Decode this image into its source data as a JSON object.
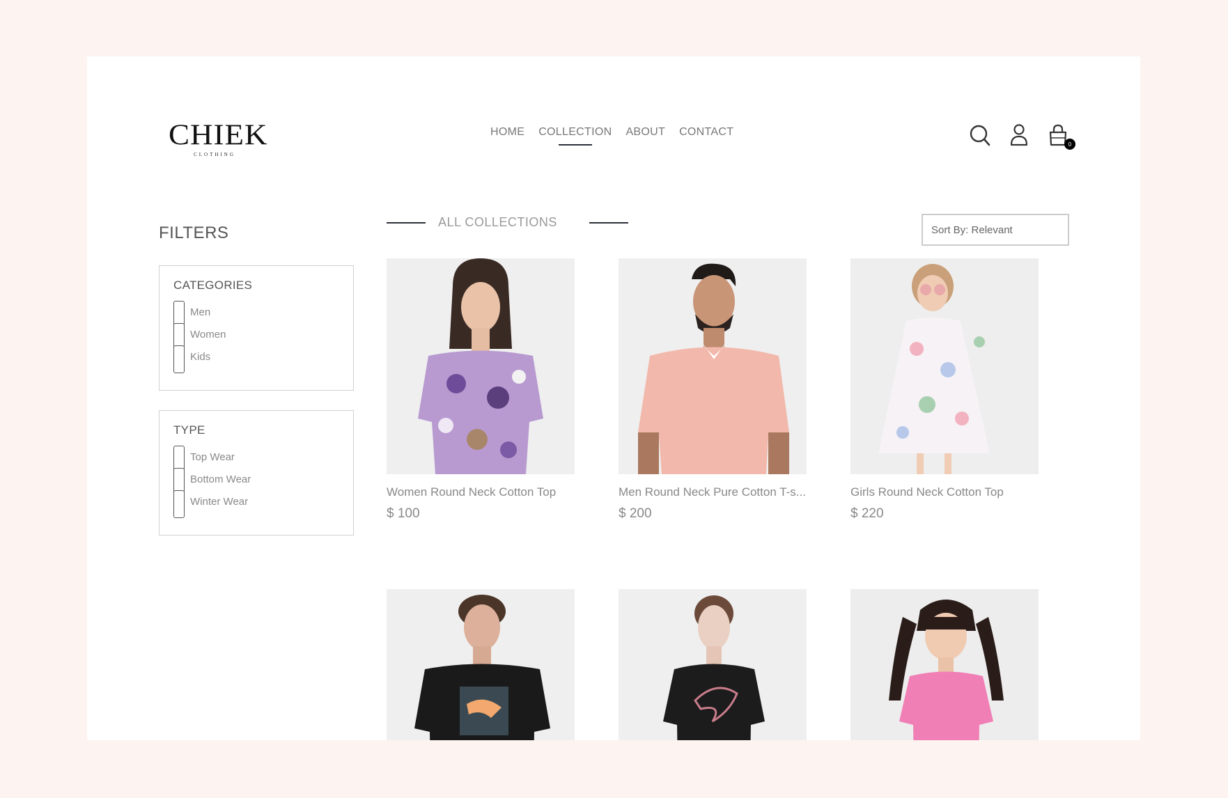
{
  "brand": {
    "logo_text": "CHIEK",
    "logo_sub": "CLOTHING"
  },
  "nav": {
    "items": [
      {
        "label": "HOME",
        "active": false
      },
      {
        "label": "COLLECTION",
        "active": true
      },
      {
        "label": "ABOUT",
        "active": false
      },
      {
        "label": "CONTACT",
        "active": false
      }
    ]
  },
  "header_icons": {
    "search": "search-icon",
    "profile": "user-icon",
    "cart": "shopping-bag-icon",
    "cart_count": "0"
  },
  "filters": {
    "title": "FILTERS",
    "categories": {
      "heading": "CATEGORIES",
      "options": [
        "Men",
        "Women",
        "Kids"
      ]
    },
    "type": {
      "heading": "TYPE",
      "options": [
        "Top Wear",
        "Bottom Wear",
        "Winter Wear"
      ]
    }
  },
  "collection": {
    "title": "ALL COLLECTIONS"
  },
  "sort": {
    "label": "Sort By: Relevant"
  },
  "products": [
    {
      "name": "Women Round Neck Cotton Top",
      "price": "$ 100"
    },
    {
      "name": "Men Round Neck Pure Cotton T-s...",
      "price": "$ 200"
    },
    {
      "name": "Girls Round Neck Cotton Top",
      "price": "$ 220"
    },
    {
      "name": "",
      "price": ""
    },
    {
      "name": "",
      "price": ""
    },
    {
      "name": "",
      "price": ""
    }
  ],
  "colors": {
    "page_bg": "#fdf3f1",
    "accent_line": "#2b2f3a",
    "image_bg": "#f1f1f1"
  }
}
